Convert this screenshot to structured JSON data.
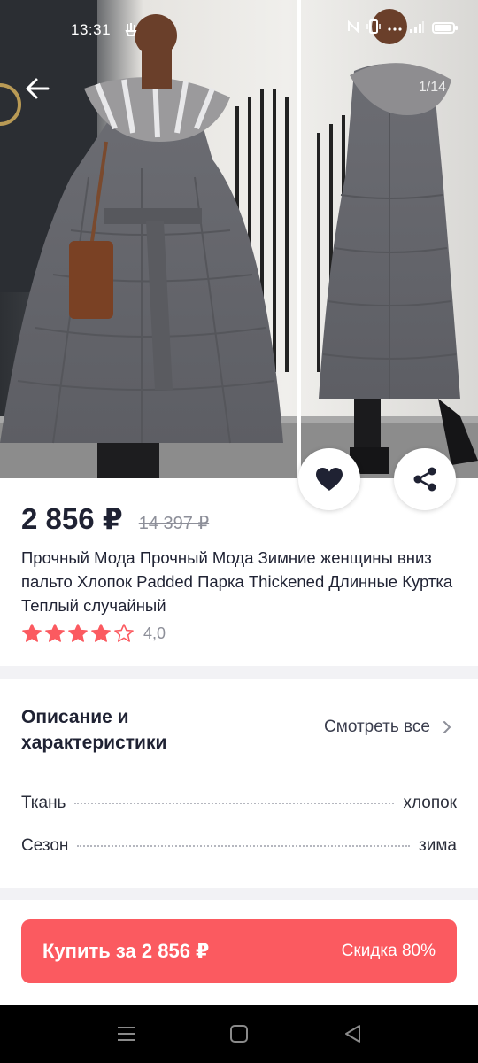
{
  "status_bar": {
    "time": "13:31",
    "dnd_icon": "do-not-disturb-icon",
    "icons": [
      "nfc-icon",
      "vibrate-icon",
      "dots-icon",
      "wifi-icon",
      "signal-icon",
      "battery-icon"
    ]
  },
  "gallery": {
    "counter": "1/14",
    "back_icon": "back-arrow-icon"
  },
  "actions": {
    "favorite_icon": "heart-icon",
    "share_icon": "share-icon"
  },
  "product": {
    "price": "2 856 ₽",
    "old_price": "14 397 ₽",
    "title": "Прочный Мода Прочный Мода Зимние женщины вниз пальто Хлопок Padded Парка Thickened Длинные Куртка Теплый случайный",
    "rating_value": "4,0",
    "rating_stars": 4,
    "rating_max": 5
  },
  "description": {
    "title": "Описание и характеристики",
    "see_all": "Смотреть все",
    "specs": [
      {
        "label": "Ткань",
        "value": "хлопок"
      },
      {
        "label": "Сезон",
        "value": "зима"
      }
    ]
  },
  "buy_button": {
    "label": "Купить за 2 856 ₽",
    "discount": "Скидка 80%"
  },
  "colors": {
    "accent": "#fb5a60",
    "star": "#fb5a60",
    "text": "#1f2233",
    "muted": "#8d8f99"
  },
  "nav": {
    "menu_icon": "menu-icon",
    "home_icon": "home-square-icon",
    "back_icon": "back-triangle-icon"
  }
}
